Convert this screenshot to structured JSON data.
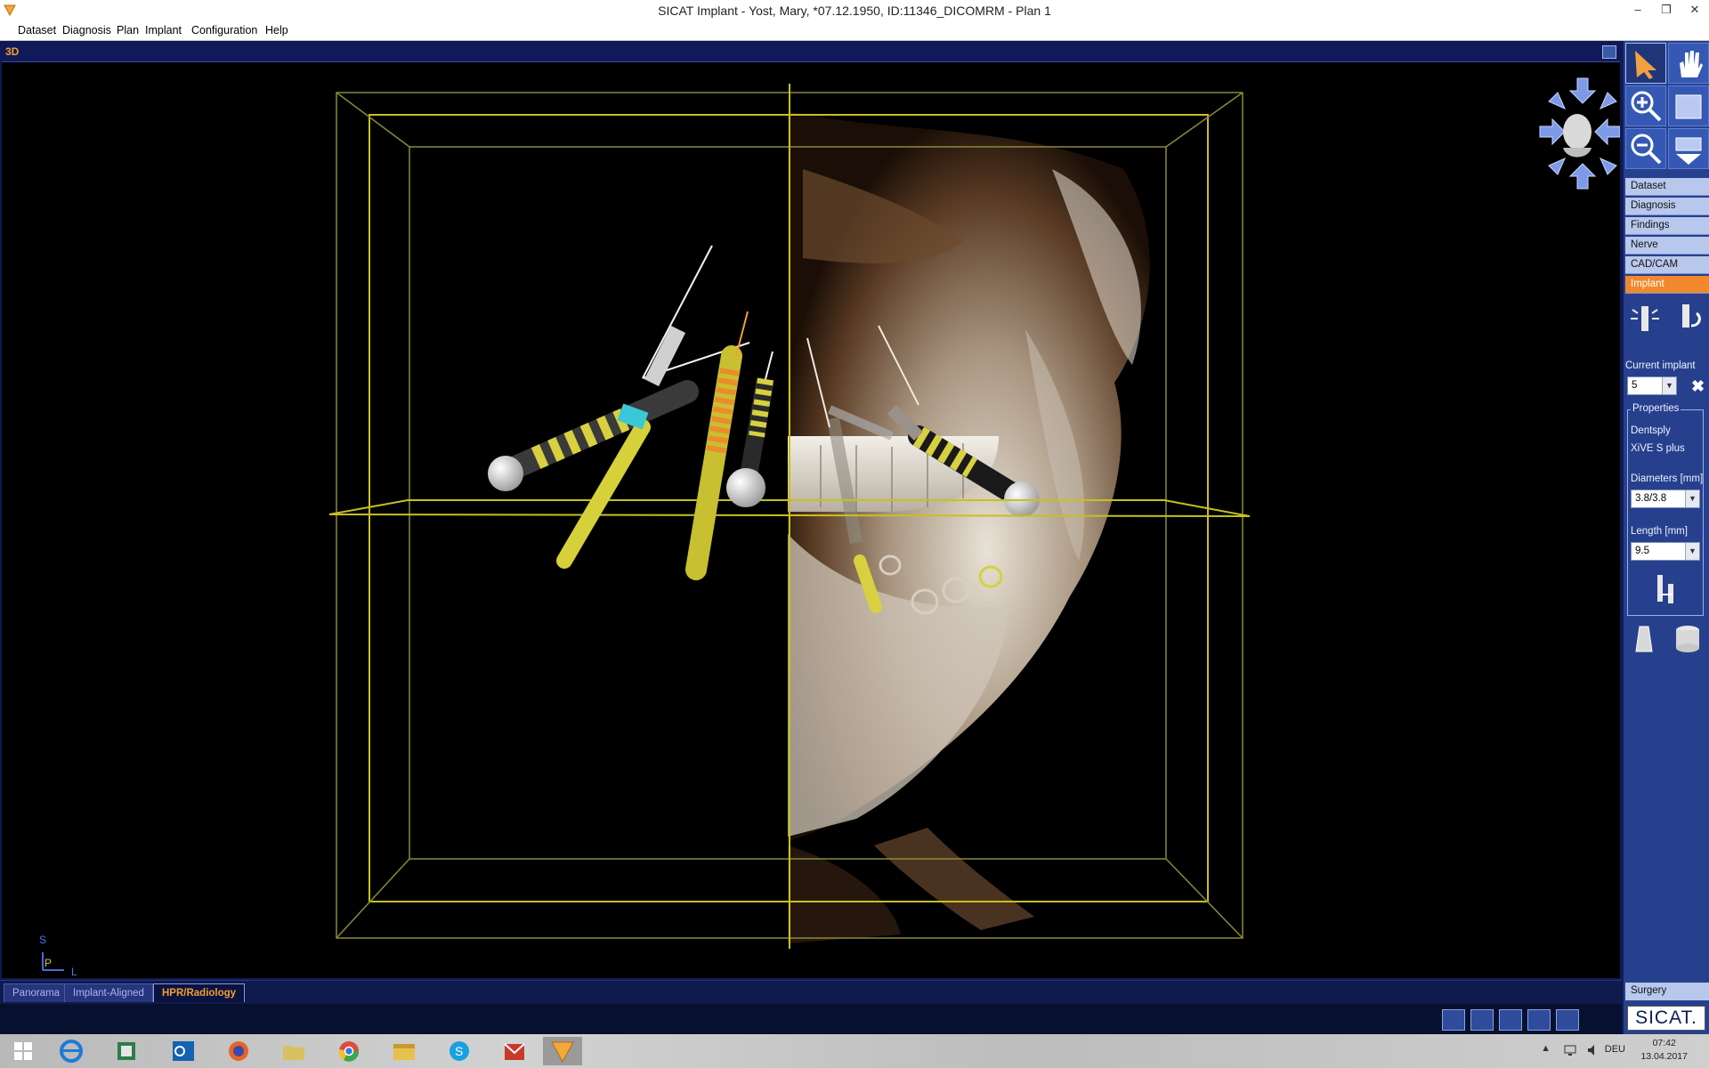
{
  "window": {
    "title": "SICAT Implant - Yost, Mary, *07.12.1950, ID:11346_DICOMRM - Plan 1",
    "minimize": "–",
    "restore": "❐",
    "close": "✕"
  },
  "menu": [
    "Dataset",
    "Diagnosis",
    "Plan",
    "Implant",
    "Configuration",
    "Help"
  ],
  "view": {
    "label": "3D",
    "orientation": {
      "s": "S",
      "p": "P",
      "l": "L"
    }
  },
  "bottom_tabs": [
    {
      "label": "Panorama",
      "active": false
    },
    {
      "label": "Implant-Aligned",
      "active": false
    },
    {
      "label": "HPR/Radiology",
      "active": true
    }
  ],
  "right_panel": {
    "nav": [
      {
        "label": "Dataset",
        "active": false
      },
      {
        "label": "Diagnosis",
        "active": false
      },
      {
        "label": "Findings",
        "active": false
      },
      {
        "label": "Nerve",
        "active": false
      },
      {
        "label": "CAD/CAM",
        "active": false
      },
      {
        "label": "Implant",
        "active": true
      }
    ],
    "current_implant_label": "Current implant",
    "current_implant_value": "5",
    "properties_label": "Properties",
    "manufacturer": "Dentsply",
    "implant_system": "XiVE S plus",
    "diameters_label": "Diameters [mm]",
    "diameters_value": "3.8/3.8",
    "length_label": "Length [mm]",
    "length_value": "9.5",
    "surgery_label": "Surgery",
    "logo_text": "SICAT."
  },
  "taskbar": {
    "language": "DEU",
    "time": "07:42",
    "date": "13.04.2017"
  },
  "colors": {
    "accent_orange": "#f2882e",
    "panel_blue": "#27408e",
    "viewport_header": "#101a5a",
    "bounding_box": "#c8c020"
  }
}
